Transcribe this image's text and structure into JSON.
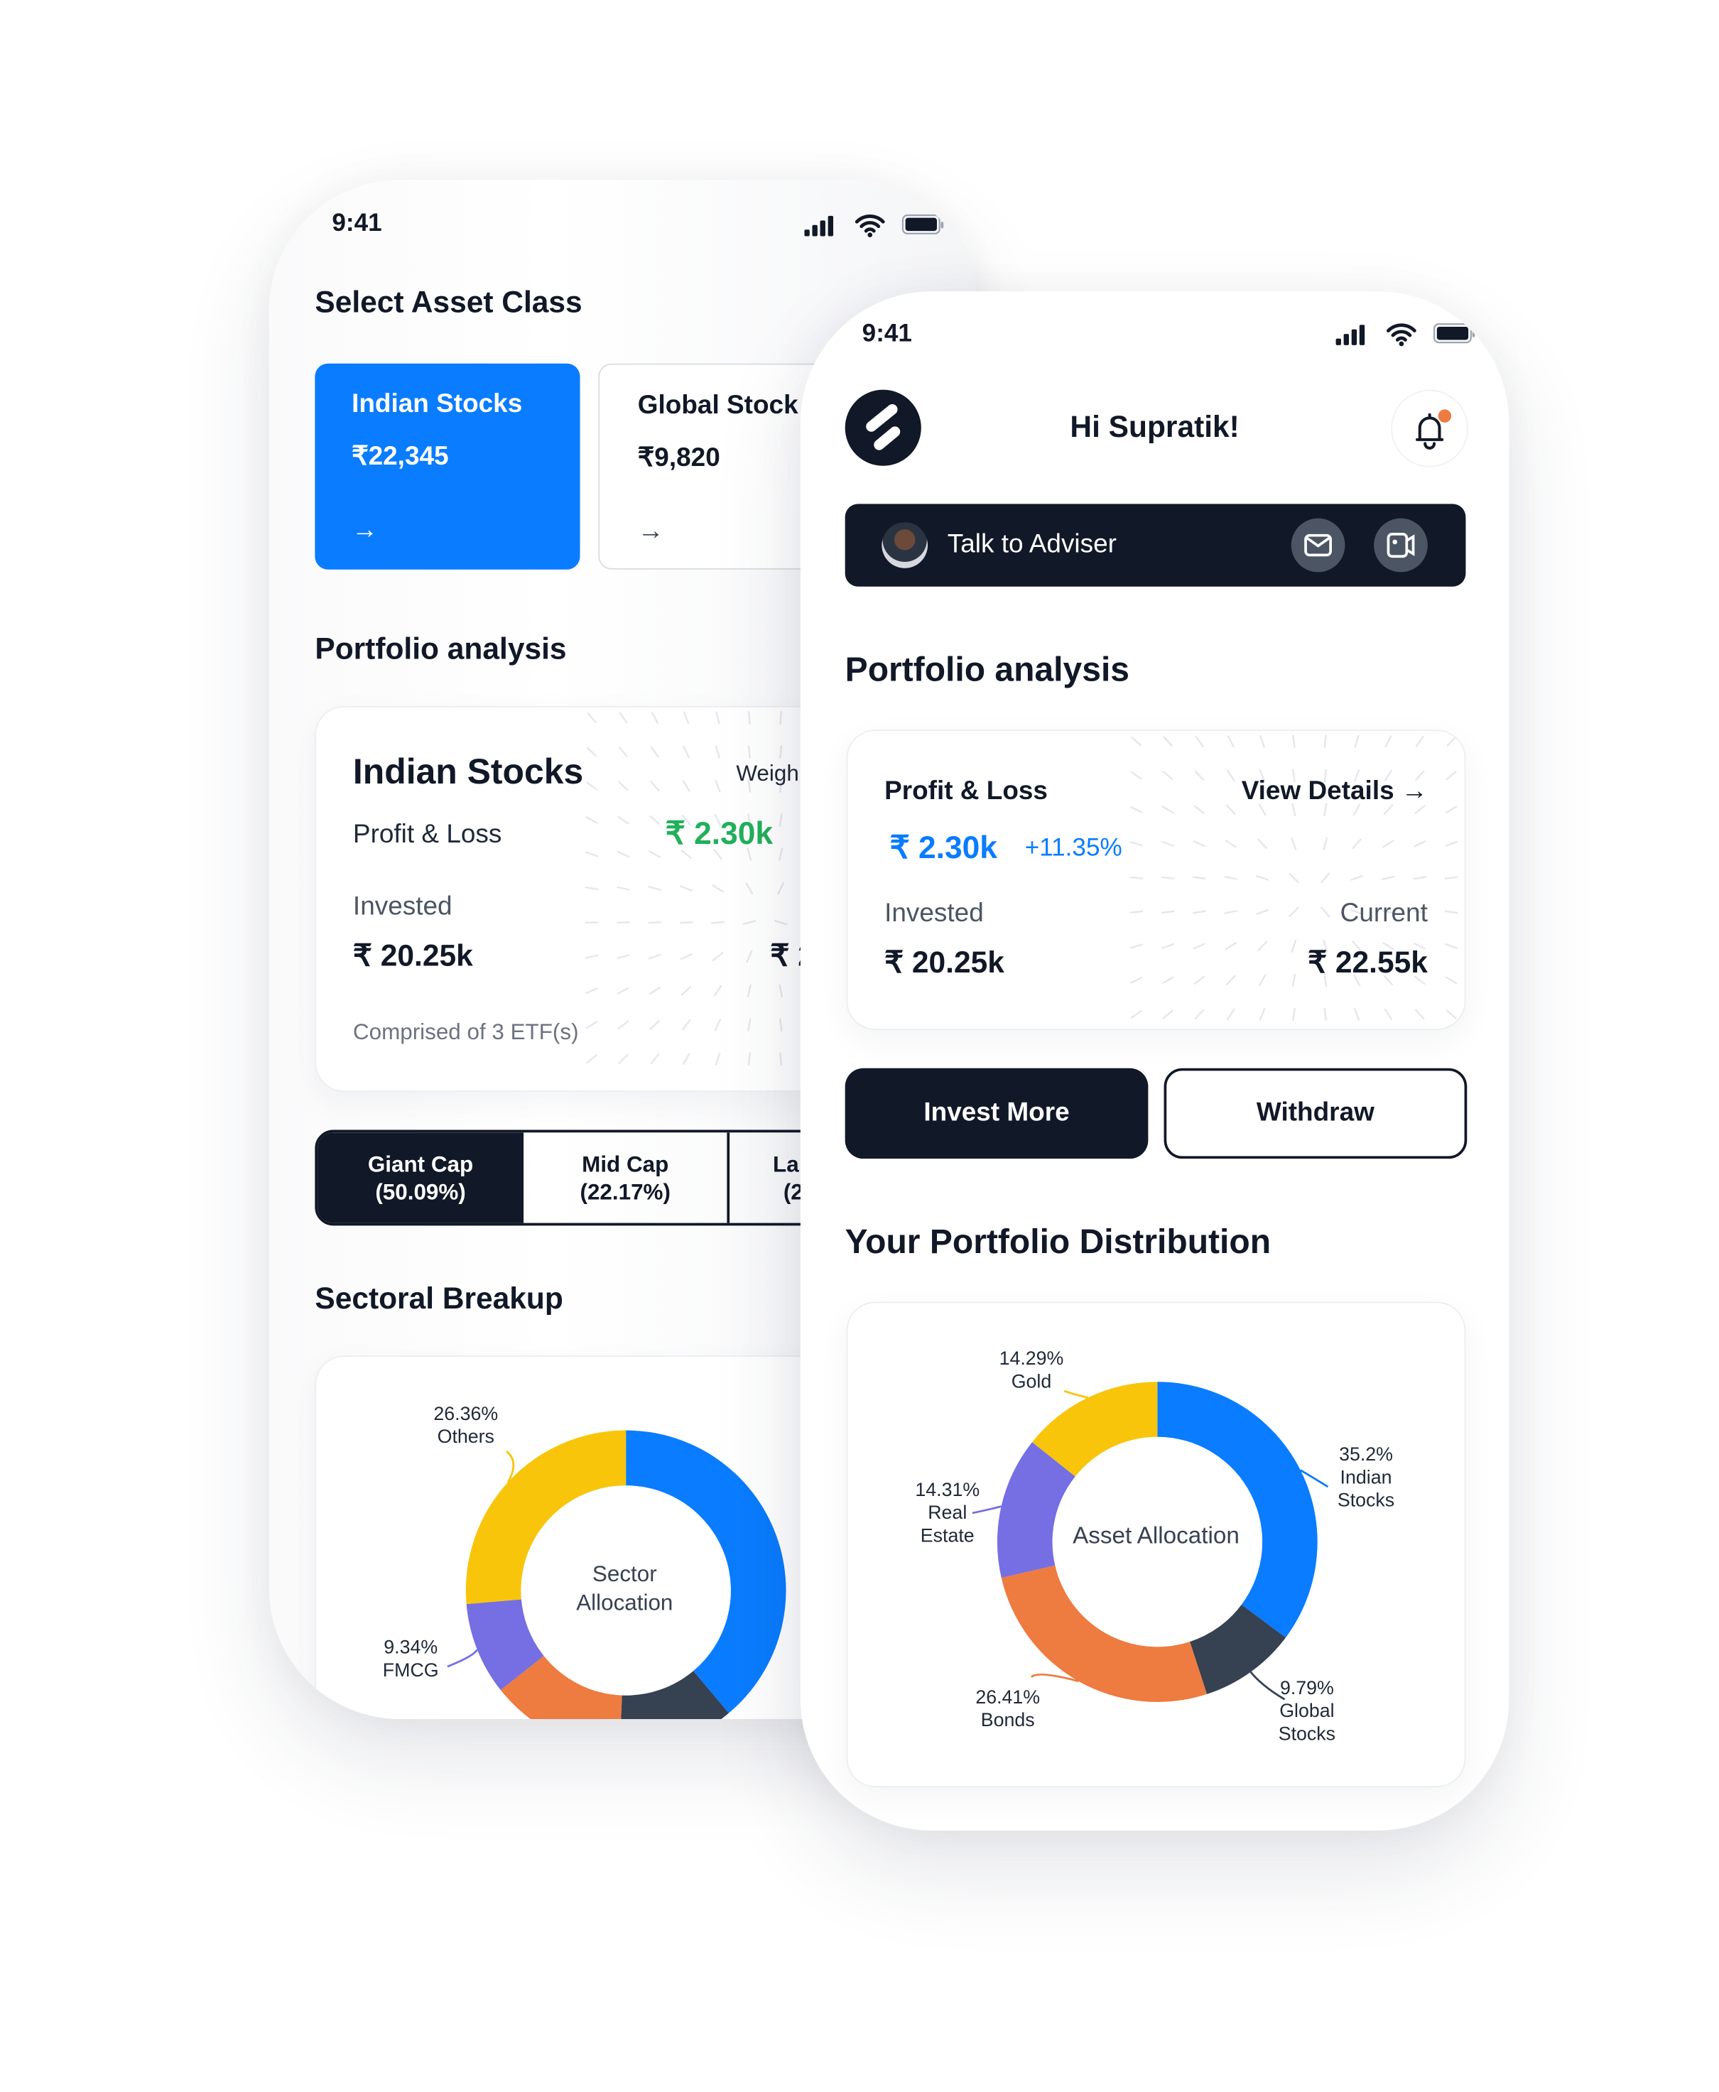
{
  "status_bar": {
    "time": "9:41"
  },
  "left_screen": {
    "select_asset_class_title": "Select Asset Class",
    "asset_cards": [
      {
        "name": "Indian Stocks",
        "value": "₹22,345",
        "selected": true
      },
      {
        "name": "Global Stock",
        "value": "₹9,820",
        "selected": false
      }
    ],
    "portfolio_title": "Portfolio analysis",
    "portfolio_card": {
      "title": "Indian Stocks",
      "weight_label": "Weigh",
      "pl_label": "Profit & Loss",
      "pl_value": "₹ 2.30k",
      "invested_label": "Invested",
      "invested_value": "₹ 20.25k",
      "current_value": "₹ 2",
      "footnote": "Comprised of 3 ETF(s)"
    },
    "cap_tabs": [
      {
        "label": "Giant Cap",
        "pct": "(50.09%)",
        "active": true
      },
      {
        "label": "Mid Cap",
        "pct": "(22.17%)",
        "active": false
      },
      {
        "label": "La",
        "pct": "(2",
        "active": false
      }
    ],
    "sectoral_title": "Sectoral Breakup",
    "chart_center": [
      "Sector",
      "Allocation"
    ]
  },
  "right_screen": {
    "greeting": "Hi Supratik!",
    "adviser_label": "Talk to Adviser",
    "portfolio_title": "Portfolio analysis",
    "pl_card": {
      "pl_label": "Profit & Loss",
      "view_details": "View Details →",
      "pl_value": "₹ 2.30k",
      "pl_pct": "+11.35%",
      "invested_label": "Invested",
      "invested_value": "₹ 20.25k",
      "current_label": "Current",
      "current_value": "₹ 22.55k"
    },
    "invest_button": "Invest More",
    "withdraw_button": "Withdraw",
    "distribution_title": "Your Portfolio Distribution",
    "chart_center": "Asset Allocation"
  },
  "colors": {
    "blue": "#0A7CFF",
    "dark": "#111827",
    "green": "#22B05B",
    "orange": "#EE7B3F",
    "purple": "#756FE3",
    "yellow": "#F8C50B",
    "slate": "#364152",
    "notification": "#EE7B3F"
  },
  "chart_data": [
    {
      "type": "pie",
      "title": "Asset Allocation",
      "series": [
        {
          "name": "Indian Stocks",
          "label": "35.2%",
          "value": 35.2,
          "color": "#0A7CFF"
        },
        {
          "name": "Global Stocks",
          "label": "9.79%",
          "value": 9.79,
          "color": "#364152"
        },
        {
          "name": "Bonds",
          "label": "26.41%",
          "value": 26.41,
          "color": "#EE7B3F"
        },
        {
          "name": "Real Estate",
          "label": "14.31%",
          "value": 14.31,
          "color": "#756FE3"
        },
        {
          "name": "Gold",
          "label": "14.29%",
          "value": 14.29,
          "color": "#F8C50B"
        }
      ]
    },
    {
      "type": "pie",
      "title": "Sector Allocation",
      "series": [
        {
          "value": 38.9,
          "color": "#0A7CFF"
        },
        {
          "value": 11.7,
          "color": "#364152"
        },
        {
          "value": 13.7,
          "color": "#EE7B3F"
        },
        {
          "name": "FMCG",
          "label": "9.34%",
          "value": 9.34,
          "color": "#756FE3"
        },
        {
          "name": "Others",
          "label": "26.36%",
          "value": 26.36,
          "color": "#F8C50B"
        }
      ]
    }
  ]
}
